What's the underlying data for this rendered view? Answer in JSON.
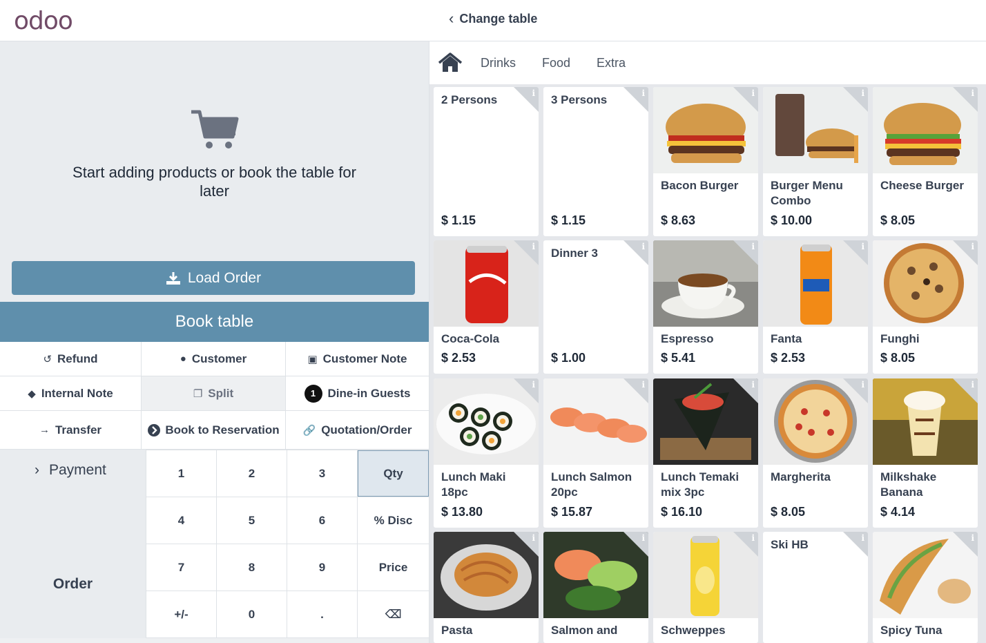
{
  "app": {
    "logo": "odoo"
  },
  "header": {
    "change_table": "Change table"
  },
  "empty_state": {
    "message": "Start adding products or book the table for later"
  },
  "actions": {
    "load_order": "Load Order",
    "book_table": "Book table",
    "refund": "Refund",
    "customer": "Customer",
    "customer_note": "Customer Note",
    "internal_note": "Internal Note",
    "split": "Split",
    "guests_count": "1",
    "dine_in_guests": "Dine-in Guests",
    "transfer": "Transfer",
    "book_to_reservation": "Book to Reservation",
    "quotation_order": "Quotation/Order",
    "payment": "Payment",
    "order": "Order"
  },
  "numpad": {
    "k1": "1",
    "k2": "2",
    "k3": "3",
    "qty": "Qty",
    "k4": "4",
    "k5": "5",
    "k6": "6",
    "disc": "% Disc",
    "k7": "7",
    "k8": "8",
    "k9": "9",
    "price": "Price",
    "plusminus": "+/-",
    "k0": "0",
    "dot": ".",
    "backspace": "⌫"
  },
  "categories": [
    "Drinks",
    "Food",
    "Extra"
  ],
  "products": [
    {
      "name": "2 Persons",
      "price": "$ 1.15"
    },
    {
      "name": "3 Persons",
      "price": "$ 1.15"
    },
    {
      "name": "Bacon Burger",
      "price": "$ 8.63"
    },
    {
      "name": "Burger Menu Combo",
      "price": "$ 10.00"
    },
    {
      "name": "Cheese Burger",
      "price": "$ 8.05"
    },
    {
      "name": "Coca-Cola",
      "price": "$ 2.53"
    },
    {
      "name": "Dinner 3",
      "price": "$ 1.00"
    },
    {
      "name": "Espresso",
      "price": "$ 5.41"
    },
    {
      "name": "Fanta",
      "price": "$ 2.53"
    },
    {
      "name": "Funghi",
      "price": "$ 8.05"
    },
    {
      "name": "Lunch Maki 18pc",
      "price": "$ 13.80"
    },
    {
      "name": "Lunch Salmon 20pc",
      "price": "$ 15.87"
    },
    {
      "name": "Lunch Temaki mix 3pc",
      "price": "$ 16.10"
    },
    {
      "name": "Margherita",
      "price": "$ 8.05"
    },
    {
      "name": "Milkshake Banana",
      "price": "$ 4.14"
    },
    {
      "name": "Pasta",
      "price": ""
    },
    {
      "name": "Salmon and",
      "price": ""
    },
    {
      "name": "Schweppes",
      "price": ""
    },
    {
      "name": "Ski HB",
      "price": ""
    },
    {
      "name": "Spicy Tuna",
      "price": ""
    }
  ],
  "colors": {
    "brand": "#714b67",
    "primary": "#5f8fac",
    "highlight": "#e00000"
  }
}
